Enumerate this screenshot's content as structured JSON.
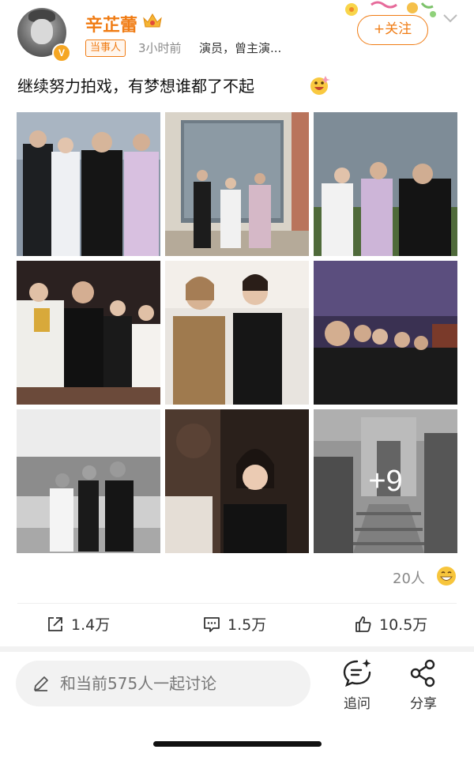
{
  "header": {
    "username": "辛芷蕾",
    "verified_badge": "V",
    "party_tag": "当事人",
    "time": "3小时前",
    "description": "演员，曾主演...",
    "follow_label": "+关注"
  },
  "post": {
    "text": "继续努力拍戏，有梦想谁都了不起",
    "more_photos_label": "+9"
  },
  "reactions": {
    "count": "20人"
  },
  "actions": {
    "repost": "1.4万",
    "comments": "1.5万",
    "likes": "10.5万"
  },
  "bottom": {
    "comment_placeholder": "和当前575人一起讨论",
    "reply_label": "追问",
    "share_label": "分享"
  },
  "colors": {
    "accent": "#f07c14"
  }
}
